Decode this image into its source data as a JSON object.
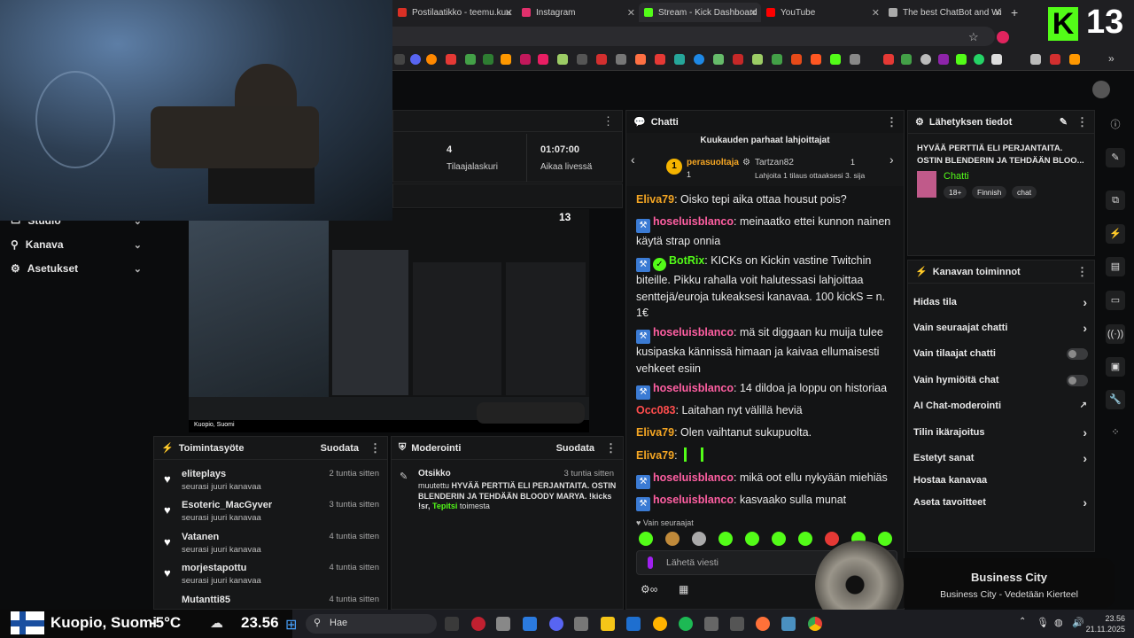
{
  "browser": {
    "tabs": [
      {
        "label": "Postilaatikko - teemu.kuu",
        "color": "#d93025"
      },
      {
        "label": "Instagram",
        "color": "#e1306c"
      },
      {
        "label": "Stream - Kick Dashboard",
        "color": "#53fc18"
      },
      {
        "label": "YouTube",
        "color": "#ff0000"
      },
      {
        "label": "The best ChatBot and Wi",
        "color": "#aaaaaa"
      }
    ],
    "new_tab": "+"
  },
  "overlay": {
    "logo_letter": "K",
    "logo_number": "13",
    "location": "Kuopio, Suomi",
    "temperature": "-5°C",
    "time_display": "23.56"
  },
  "nav": {
    "items": [
      {
        "label": "Studio"
      },
      {
        "label": "Kanava"
      },
      {
        "label": "Asetukset"
      }
    ]
  },
  "stats": {
    "subs_count": "4",
    "subs_label": "Tilaajalaskuri",
    "live_time": "01:07:00",
    "live_label": "Aikaa livessä"
  },
  "activity": {
    "title": "Toimintasyöte",
    "filter": "Suodata",
    "items": [
      {
        "name": "eliteplays",
        "sub": "seurasi juuri kanavaa",
        "time": "2 tuntia sitten"
      },
      {
        "name": "Esoteric_MacGyver",
        "sub": "seurasi juuri kanavaa",
        "time": "3 tuntia sitten"
      },
      {
        "name": "Vatanen",
        "sub": "seurasi juuri kanavaa",
        "time": "4 tuntia sitten"
      },
      {
        "name": "morjestapottu",
        "sub": "seurasi juuri kanavaa",
        "time": "4 tuntia sitten"
      },
      {
        "name": "Mutantti85",
        "sub": "",
        "time": "4 tuntia sitten"
      }
    ]
  },
  "moderation": {
    "title": "Moderointi",
    "filter": "Suodata",
    "entry_title": "Otsikko",
    "entry_time": "3 tuntia sitten",
    "entry_prefix": "muutettu",
    "entry_value": "HYVÄÄ PERTTIÄ ELI PERJANTAITA. OSTIN BLENDERIN JA TEHDÄÄN BLOODY MARYA. !kicks !sr,",
    "entry_user": "Tepitsi",
    "entry_suffix": "toimesta"
  },
  "chat": {
    "title": "Chatti",
    "gifters_title": "Kuukauden parhaat lahjoittajat",
    "gifter1_name": "perasuoltaja",
    "gifter1_count": "1",
    "gifter1_rank": "1",
    "gifter2_name": "Tartzan82",
    "gifter2_count": "1",
    "gifter_note": "Lahjoita 1 tilaus ottaaksesi 3. sija",
    "messages": [
      {
        "user": "Eliva79",
        "color": "#f5a623",
        "text": "Oisko tepi aika ottaa housut pois?",
        "badge": "none"
      },
      {
        "user": "hoseluisblanco",
        "color": "#ff5fa2",
        "text": "meinaatko ettei kunnon nainen käytä strap onnia",
        "badge": "blue"
      },
      {
        "user": "BotRix",
        "color": "#53fc18",
        "text": "KICKs on Kickin vastine Twitchin biteille. Pikku rahalla voit halutessasi lahjoittaa senttejä/euroja tukeaksesi kanavaa. 100 kickS = n. 1€",
        "badge": "bot"
      },
      {
        "user": "hoseluisblanco",
        "color": "#ff5fa2",
        "text": "mä sit diggaan ku muija tulee kusipaska kännissä himaan ja kaivaa ellumaisesti vehkeet esiin",
        "badge": "blue"
      },
      {
        "user": "hoseluisblanco",
        "color": "#ff5fa2",
        "text": "14 dildoa ja loppu on historiaa",
        "badge": "blue"
      },
      {
        "user": "Occ083",
        "color": "#ff4d4d",
        "text": "Laitahan nyt välillä heviä",
        "badge": "none"
      },
      {
        "user": "Eliva79",
        "color": "#f5a623",
        "text": "Olen vaihtanut sukupuolta.",
        "badge": "none"
      },
      {
        "user": "Eliva79",
        "color": "#f5a623",
        "text": "",
        "badge": "none"
      },
      {
        "user": "hoseluisblanco",
        "color": "#ff5fa2",
        "text": "mikä oot ellu nykyään miehiäs",
        "badge": "blue"
      },
      {
        "user": "hoseluisblanco",
        "color": "#ff5fa2",
        "text": "kasvaako sulla munat",
        "badge": "blue"
      }
    ],
    "followers_only": "Vain seuraajat",
    "input_placeholder": "Lähetä viesti"
  },
  "stream_info": {
    "title": "Lähetyksen tiedot",
    "stream_title": "HYVÄÄ PERTTIÄ ELI PERJANTAITA. OSTIN BLENDERIN JA TEHDÄÄN BLOO...",
    "category": "Chatti",
    "tags": [
      "18+",
      "Finnish",
      "chat"
    ]
  },
  "channel_actions": {
    "title": "Kanavan toiminnot",
    "items": [
      {
        "label": "Hidas tila",
        "control": "chevron"
      },
      {
        "label": "Vain seuraajat chatti",
        "control": "chevron"
      },
      {
        "label": "Vain tilaajat chatti",
        "control": "toggle"
      },
      {
        "label": "Vain hymiöitä chat",
        "control": "toggle"
      },
      {
        "label": "AI Chat-moderointi",
        "control": "external"
      },
      {
        "label": "Tilin ikärajoitus",
        "control": "chevron"
      },
      {
        "label": "Estetyt sanat",
        "control": "chevron"
      },
      {
        "label": "Hostaa kanavaa",
        "control": "none"
      },
      {
        "label": "Aseta tavoitteet",
        "control": "chevron"
      }
    ]
  },
  "now_playing": {
    "title": "Business City",
    "subtitle": "Business City - Vedetään Kierteel"
  },
  "taskbar": {
    "search_placeholder": "Hae",
    "time": "23.56",
    "date": "21.11.2025"
  }
}
